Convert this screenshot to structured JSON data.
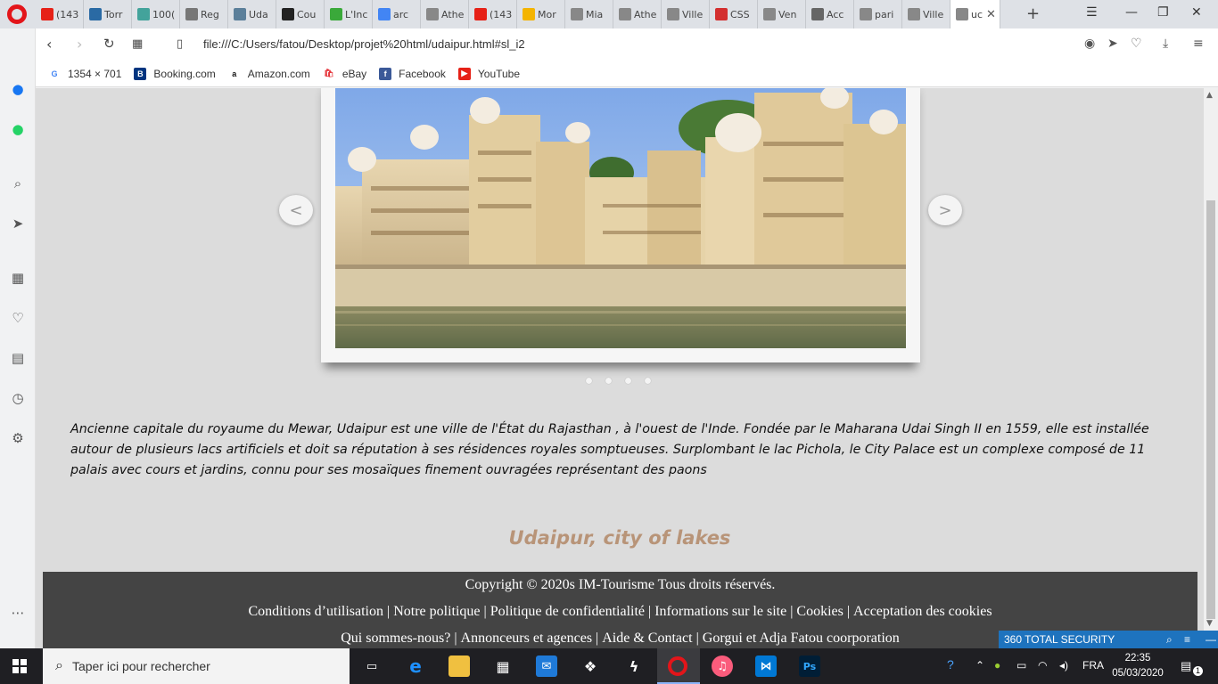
{
  "browser": {
    "tabs": [
      {
        "label": "(143",
        "color": "#e62117"
      },
      {
        "label": "Torr",
        "color": "#2a6aa4"
      },
      {
        "label": "100(",
        "color": "#43a39b"
      },
      {
        "label": "Reg",
        "color": "#777777"
      },
      {
        "label": "Uda",
        "color": "#5b7f9a"
      },
      {
        "label": "Cou",
        "color": "#222222"
      },
      {
        "label": "L'Inc",
        "color": "#3aa93a"
      },
      {
        "label": "arc",
        "color": "#4285f4"
      },
      {
        "label": "Athe",
        "color": "#888888"
      },
      {
        "label": "(143",
        "color": "#e62117"
      },
      {
        "label": "Mor",
        "color": "#f4b400"
      },
      {
        "label": "Mia",
        "color": "#888888"
      },
      {
        "label": "Athe",
        "color": "#888888"
      },
      {
        "label": "Ville",
        "color": "#888888"
      },
      {
        "label": "CSS",
        "color": "#d32f2f"
      },
      {
        "label": "Ven",
        "color": "#888888"
      },
      {
        "label": "Acc",
        "color": "#666666"
      },
      {
        "label": "pari",
        "color": "#888888"
      },
      {
        "label": "Ville",
        "color": "#888888"
      }
    ],
    "active_tab": "uc",
    "url": "file:///C:/Users/fatou/Desktop/projet%20html/udaipur.html#sl_i2",
    "bookmarks": [
      {
        "label": "1354 × 701",
        "icon": "google-icon",
        "color": "#ffffff"
      },
      {
        "label": "Booking.com",
        "icon": "booking-icon",
        "color": "#003580"
      },
      {
        "label": "Amazon.com",
        "icon": "amazon-icon",
        "color": "#ffffff"
      },
      {
        "label": "eBay",
        "icon": "ebay-icon",
        "color": "#ffffff"
      },
      {
        "label": "Facebook",
        "icon": "facebook-icon",
        "color": "#3b5998"
      },
      {
        "label": "YouTube",
        "icon": "youtube-icon",
        "color": "#e62117"
      }
    ]
  },
  "page": {
    "slider": {
      "prev": "<",
      "next": ">",
      "slide_count": 4
    },
    "description": "Ancienne capitale du royaume du Mewar, Udaipur est une ville de l'État du Rajasthan , à l'ouest de l'Inde. Fondée par le Maharana Udai Singh II en 1559, elle est installée autour de plusieurs lacs artificiels et doit sa réputation à ses résidences royales somptueuses. Surplombant le lac Pichola, le City Palace est un complexe composé de 11 palais avec cours et jardins, connu pour ses mosaïques finement ouvragées représentant des paons",
    "tagline": "Udaipur, city of lakes",
    "footer": {
      "copyright": "Copyright © 2020s IM-Tourisme Tous droits réservés.",
      "row1": [
        "Conditions d’utilisation",
        "Notre politique",
        "Politique de confidentialité",
        "Informations sur le site",
        "Cookies",
        "Acceptation des cookies"
      ],
      "row2": [
        "Qui sommes-nous?",
        "Annonceurs et agences",
        "Aide & Contact",
        "Gorgui et Adja Fatou coorporation"
      ]
    }
  },
  "security_widget": "360 TOTAL SECURITY",
  "taskbar": {
    "search_placeholder": "Taper ici pour rechercher",
    "lang": "FRA",
    "time": "22:35",
    "date": "05/03/2020",
    "notifications": "1"
  }
}
